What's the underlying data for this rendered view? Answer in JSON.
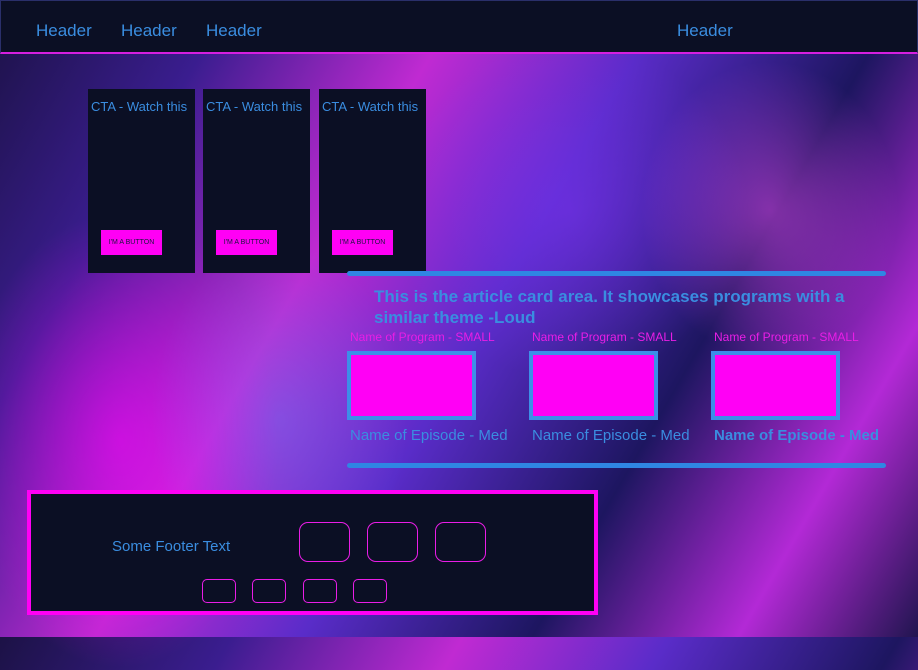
{
  "header": {
    "items": [
      "Header",
      "Header",
      "Header",
      "Header"
    ]
  },
  "cta_cards": [
    {
      "title": "CTA - Watch this",
      "button_label": "I'M A BUTTON"
    },
    {
      "title": "CTA - Watch this",
      "button_label": "I'M A BUTTON"
    },
    {
      "title": "CTA - Watch this",
      "button_label": "I'M A BUTTON"
    }
  ],
  "articles": {
    "heading": "This is the article card area. It showcases programs with a similar theme -Loud",
    "cards": [
      {
        "program": "Name of Program - SMALL",
        "episode": "Name of Episode - Med"
      },
      {
        "program": "Name of Program - SMALL",
        "episode": "Name of Episode - Med"
      },
      {
        "program": "Name of Program - SMALL",
        "episode": "Name of Episode - Med"
      }
    ]
  },
  "footer": {
    "text": "Some Footer Text"
  },
  "colors": {
    "accent_magenta": "#ff00f5",
    "accent_blue": "#3a8de0",
    "panel_dark": "#0b0f24"
  }
}
